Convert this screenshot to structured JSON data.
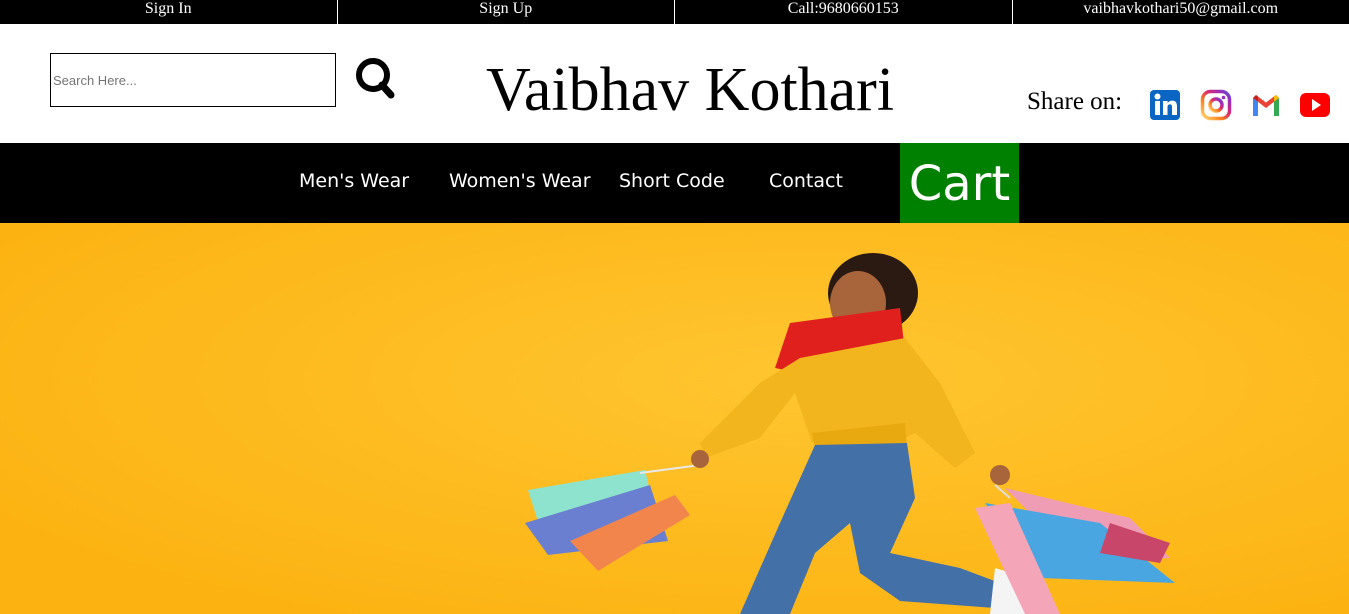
{
  "topbar": {
    "sign_in": "Sign In",
    "sign_up": "Sign Up",
    "call": "Call:9680660153",
    "email": "vaibhavkothari50@gmail.com"
  },
  "header": {
    "search_placeholder": "Search Here...",
    "brand": "Vaibhav Kothari",
    "share_label": "Share on:",
    "social_icons": [
      "linkedin-icon",
      "instagram-icon",
      "gmail-icon",
      "youtube-icon"
    ]
  },
  "nav": {
    "items": [
      "Men's Wear",
      "Women's Wear",
      "Short Code",
      "Contact"
    ],
    "cart": "Cart"
  },
  "hero": {
    "background": "#fdb817",
    "image": "woman-jumping-with-shopping-bags"
  },
  "colors": {
    "topbar_bg": "#000000",
    "nav_bg": "#000000",
    "cart_bg": "#008000"
  }
}
